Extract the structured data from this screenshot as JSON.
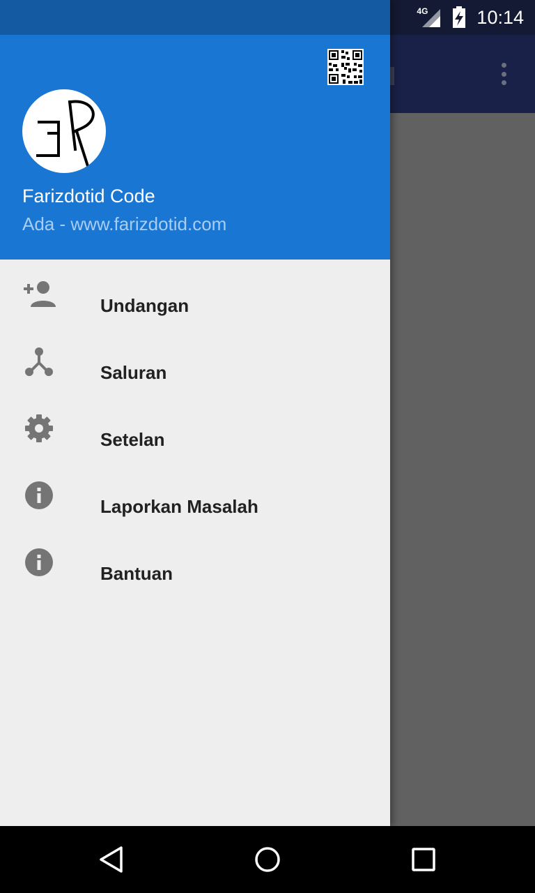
{
  "status_bar": {
    "network": "4G",
    "time": "10:14"
  },
  "drawer": {
    "header": {
      "name": "Farizdotid Code",
      "subtitle": "Ada - www.farizdotid.com",
      "avatar_icon": "logo-icon",
      "qr_icon": "qr-code-icon"
    },
    "items": [
      {
        "label": "Undangan",
        "icon": "add-person-icon"
      },
      {
        "label": "Saluran",
        "icon": "channel-icon"
      },
      {
        "label": "Setelan",
        "icon": "gear-icon"
      },
      {
        "label": "Laporkan Masalah",
        "icon": "info-icon"
      },
      {
        "label": "Bantuan",
        "icon": "info-icon"
      }
    ]
  },
  "colors": {
    "header": "#1976d2",
    "drawer_status": "#135aa3",
    "drawer_bg": "#eeeeee",
    "icon": "#757575",
    "scrim": "#616161"
  },
  "navigation": {
    "back": "back-icon",
    "home": "home-icon",
    "recents": "recents-icon"
  }
}
